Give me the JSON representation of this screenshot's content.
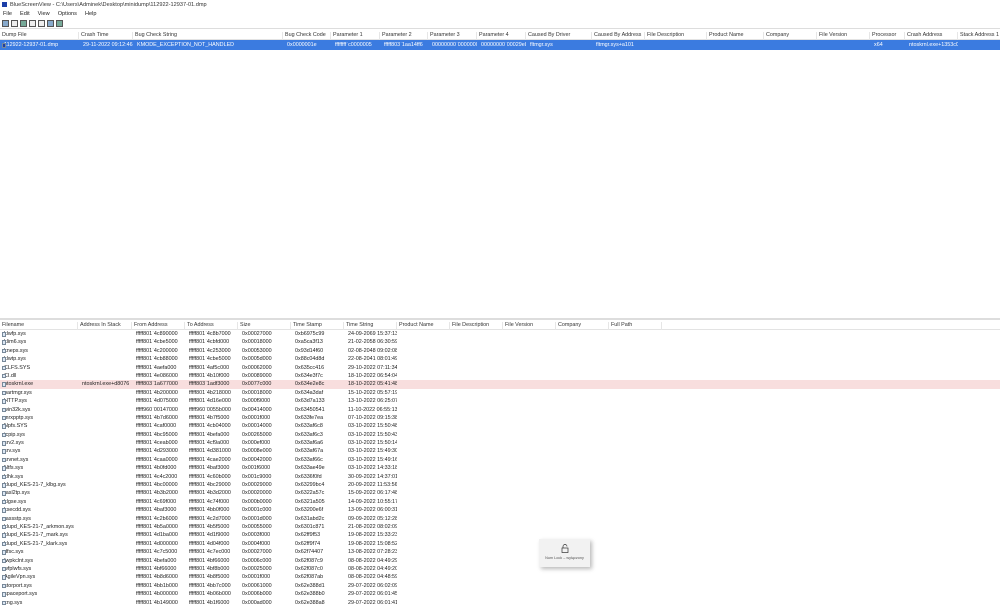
{
  "window": {
    "title": "BlueScreenView  -  C:\\Users\\Adminek\\Desktop\\minidump\\112922-12937-01.dmp"
  },
  "menu": [
    "File",
    "Edit",
    "View",
    "Options",
    "Help"
  ],
  "toolbar": [
    "properties-icon",
    "save-icon",
    "html-report-icon",
    "copy-icon",
    "options-icon",
    "refresh-icon",
    "exit-icon"
  ],
  "upper": {
    "columns": [
      [
        "Dump File",
        0,
        79
      ],
      [
        "Crash Time",
        79,
        54
      ],
      [
        "Bug Check String",
        133,
        150
      ],
      [
        "Bug Check Code",
        283,
        48
      ],
      [
        "Parameter 1",
        331,
        49
      ],
      [
        "Parameter 2",
        380,
        48
      ],
      [
        "Parameter 3",
        428,
        49
      ],
      [
        "Parameter 4",
        477,
        49
      ],
      [
        "Caused By Driver",
        526,
        66
      ],
      [
        "Caused By Address",
        592,
        53
      ],
      [
        "File Description",
        645,
        62
      ],
      [
        "Product Name",
        707,
        57
      ],
      [
        "Company",
        764,
        53
      ],
      [
        "File Version",
        817,
        53
      ],
      [
        "Processor",
        870,
        35
      ],
      [
        "Crash Address",
        905,
        53
      ],
      [
        "Stack Address 1",
        958,
        45
      ]
    ],
    "rows": [
      [
        "112922-12937-01.dmp",
        "29-11-2022 09:12:46",
        "KMODE_EXCEPTION_NOT_HANDLED",
        "0x0000001e",
        "ffffffff`c0000005",
        "fffff803`1aa14ff6",
        "00000000`0000000...",
        "00000000`00029e8",
        "fltmgr.sys",
        "fltmgr.sys+a101",
        "",
        "",
        "",
        "",
        "x64",
        "ntoskrnl.exe+1353c0",
        ""
      ]
    ]
  },
  "lower": {
    "columns": [
      [
        "Filename",
        0,
        78
      ],
      [
        "Address In Stack",
        78,
        54
      ],
      [
        "From Address",
        132,
        53
      ],
      [
        "To Address",
        185,
        53
      ],
      [
        "Size",
        238,
        53
      ],
      [
        "Time Stamp",
        291,
        53
      ],
      [
        "Time String",
        344,
        53
      ],
      [
        "Product Name",
        397,
        53
      ],
      [
        "File Description",
        450,
        53
      ],
      [
        "File Version",
        503,
        53
      ],
      [
        "Company",
        556,
        53
      ],
      [
        "Full Path",
        609,
        53
      ]
    ],
    "rows": [
      [
        "klwfp.sys",
        "",
        "fffff801`4c890000",
        "fffff801`4c8b7000",
        "0x00027000",
        "0xb6975c99",
        "24-09-2069 15:37:13"
      ],
      [
        "klim6.sys",
        "",
        "fffff801`4cbe5000",
        "fffff801`4cbfd000",
        "0x00018000",
        "0xa5ca3f13",
        "21-02-2058 06:30:59"
      ],
      [
        "kneps.sys",
        "",
        "fffff801`4c200000",
        "fffff801`4c253000",
        "0x00053000",
        "0x93d14f60",
        "02-08-2048 09:02:08"
      ],
      [
        "klwtp.sys",
        "",
        "fffff801`4cb88000",
        "fffff801`4cbe5000",
        "0x0005d000",
        "0x88c04d8d",
        "22-08-2041 08:01:49"
      ],
      [
        "CLFS.SYS",
        "",
        "fffff801`4aefa000",
        "fffff801`4af5c000",
        "0x00062000",
        "0x635cc416",
        "29-10-2022 07:11:34"
      ],
      [
        "CI.dll",
        "",
        "fffff801`4e086000",
        "fffff801`4b10f000",
        "0x00089000",
        "0x634e3f7c",
        "18-10-2022 06:54:04"
      ],
      [
        "ntoskrnl.exe",
        "ntoskrnl.exe+d8076",
        "fffff803`1a677000",
        "fffff803`1adf3000",
        "0x0077c000",
        "0x634e2e8c",
        "18-10-2022 05:41:48"
      ],
      [
        "partmgr.sys",
        "",
        "fffff801`4b200000",
        "fffff801`4b218000",
        "0x00018000",
        "0x634a3daf",
        "15-10-2022 05:57:19"
      ],
      [
        "HTTP.sys",
        "",
        "fffff801`4d075000",
        "fffff801`4d16e000",
        "0x000f9000",
        "0x63d7a133",
        "13-10-2022 06:25:07"
      ],
      [
        "win32k.sys",
        "",
        "fffff960`00147000",
        "fffff960`0055b000",
        "0x00414000",
        "0x63450541",
        "11-10-2022 06:55:13"
      ],
      [
        "mrxpptp.sys",
        "",
        "fffff801`4b7d6000",
        "fffff801`4b7f5000",
        "0x0001f000",
        "0x633fe7ea",
        "07-10-2022 09:15:38"
      ],
      [
        "Npfs.SYS",
        "",
        "fffff801`4caf0000",
        "fffff801`4cb04000",
        "0x00014000",
        "0x633af6c8",
        "03-10-2022 15:50:48"
      ],
      [
        "tcpip.sys",
        "",
        "fffff801`4bc95000",
        "fffff801`4befa000",
        "0x00265000",
        "0x633af6c3",
        "03-10-2022 15:50:43"
      ],
      [
        "srv2.sys",
        "",
        "fffff801`4ceab000",
        "fffff801`4cf9a000",
        "0x000ef000",
        "0x633af6a6",
        "03-10-2022 15:50:14"
      ],
      [
        "srv.sys",
        "",
        "fffff801`4d293000",
        "fffff801`4d381000",
        "0x0008e000",
        "0x633af67a",
        "03-10-2022 15:49:30"
      ],
      [
        "srvnet.sys",
        "",
        "fffff801`4caa0000",
        "fffff801`4cae2000",
        "0x00042000",
        "0x633af66c",
        "03-10-2022 15:49:16"
      ],
      [
        "Ntfs.sys",
        "",
        "fffff801`4b0fd000",
        "fffff801`4baf3000",
        "0x001f6000",
        "0x633ae49e",
        "03-10-2022 14:33:18"
      ],
      [
        "klhk.sys",
        "",
        "fffff801`4c4c2000",
        "fffff801`4c60b000",
        "0x001c9000",
        "0x6336f0fd",
        "30-09-2022 14:37:01"
      ],
      [
        "klupd_KES-21-7_klbg.sys",
        "",
        "fffff801`4bc00000",
        "fffff801`4bc29000",
        "0x00029000",
        "0x63299bc4",
        "20-09-2022 11:53:56"
      ],
      [
        "rasl2tp.sys",
        "",
        "fffff801`4b3b2000",
        "fffff801`4b3d2000",
        "0x00020000",
        "0x6322a57c",
        "15-09-2022 06:17:48"
      ],
      [
        "klgse.sys",
        "",
        "fffff801`4c69f000",
        "fffff801`4c74f000",
        "0x000b0000",
        "0x6321a505",
        "14-09-2022 10:55:17"
      ],
      [
        "ksecdd.sys",
        "",
        "fffff801`4baf3000",
        "fffff801`4bb0f000",
        "0x0001c000",
        "0x63200e6f",
        "13-09-2022 06:00:31"
      ],
      [
        "rassstp.sys",
        "",
        "fffff801`4c2b6000",
        "fffff801`4c2d7000",
        "0x0001d000",
        "0x631abd2c",
        "09-09-2022 05:12:28"
      ],
      [
        "klupd_KES-21-7_arkmon.sys",
        "",
        "fffff801`4b5a0000",
        "fffff801`4b5f5000",
        "0x00055000",
        "0x6301c871",
        "21-08-2022 08:02:09"
      ],
      [
        "klupd_KES-21-7_mark.sys",
        "",
        "fffff801`4d1ba000",
        "fffff801`4d1f9000",
        "0x0003f000",
        "0x62ff9f53",
        "19-08-2022 15:33:23"
      ],
      [
        "klupd_KES-21-7_klark.sys",
        "",
        "fffff801`4d000000",
        "fffff801`4d04f000",
        "0x0004f000",
        "0x62ff9f74",
        "19-08-2022 15:08:52"
      ],
      [
        "dfsc.sys",
        "",
        "fffff801`4c7c5000",
        "fffff801`4c7ec000",
        "0x00027000",
        "0x62f74407",
        "13-08-2022 07:28:23"
      ],
      [
        "fwpkclnt.sys",
        "",
        "fffff801`4befa000",
        "fffff801`4bf66000",
        "0x0006c000",
        "0x62f087c9",
        "08-08-2022 04:49:29"
      ],
      [
        "wfplwfs.sys",
        "",
        "fffff801`4bf66000",
        "fffff801`4bf8b000",
        "0x00025000",
        "0x62f087c0",
        "08-08-2022 04:49:20"
      ],
      [
        "AgileVpn.sys",
        "",
        "fffff801`4b8d6000",
        "fffff801`4b8f5000",
        "0x0001f000",
        "0x62f087ab",
        "08-08-2022 04:48:59"
      ],
      [
        "storport.sys",
        "",
        "fffff801`4bb1b000",
        "fffff801`4bb7c000",
        "0x00061000",
        "0x62e388d1",
        "29-07-2022 06:02:09"
      ],
      [
        "spaceport.sys",
        "",
        "fffff801`4b000000",
        "fffff801`4b06b000",
        "0x0006b000",
        "0x62e388b0",
        "29-07-2022 06:01:45"
      ],
      [
        "cng.sys",
        "",
        "fffff801`4b149000",
        "fffff801`4b1f6000",
        "0x000ad000",
        "0x62e388a8",
        "29-07-2022 06:01:41"
      ]
    ],
    "highlight_row": 6
  },
  "popup": {
    "text": "Num Lock – wyłączony",
    "icon": "unlock-icon"
  },
  "colors": {
    "selected": "#3b7be0",
    "highlight": "#f8dede"
  }
}
